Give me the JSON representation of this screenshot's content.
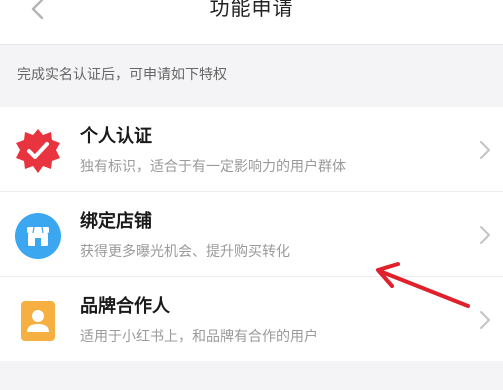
{
  "nav": {
    "title": "功能申请",
    "back_icon": "chevron-left-icon"
  },
  "notice": "完成实名认证后，可申请如下特权",
  "items": [
    {
      "title": "个人认证",
      "desc": "独有标识，适合于有一定影响力的用户群体",
      "icon": "verified-badge-icon",
      "icon_color": "#e8343f"
    },
    {
      "title": "绑定店铺",
      "desc": "获得更多曝光机会、提升购买转化",
      "icon": "store-icon",
      "icon_color": "#3aa7f0"
    },
    {
      "title": "品牌合作人",
      "desc": "适用于小红书上，和品牌有合作的用户",
      "icon": "person-badge-icon",
      "icon_color": "#f5b041"
    }
  ],
  "colors": {
    "background": "#f4f4f6",
    "annotation_arrow": "#e0202a"
  }
}
